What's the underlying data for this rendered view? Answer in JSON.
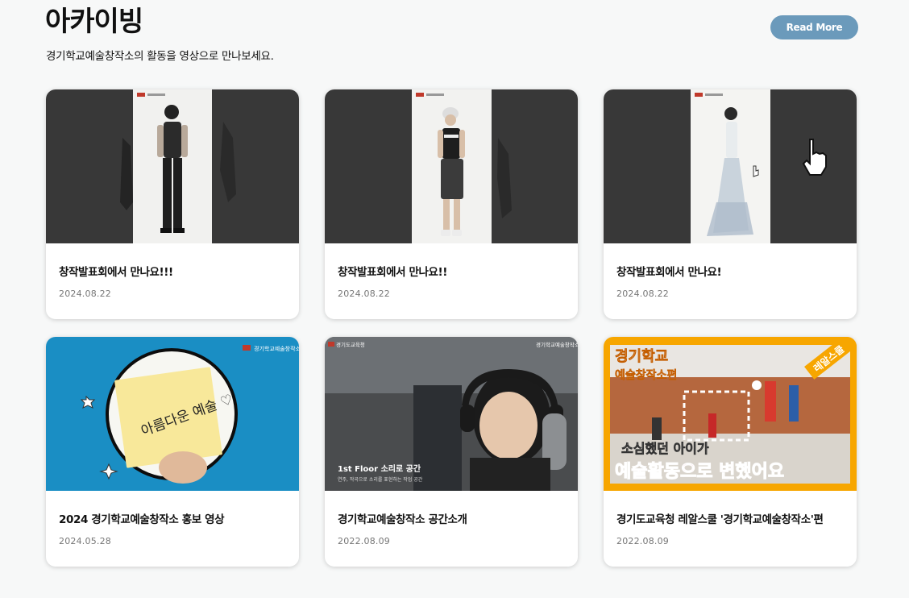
{
  "header": {
    "title": "아카이빙",
    "description": "경기학교예술창작소의 활동을 영상으로 만나보세요.",
    "read_more_label": "Read More"
  },
  "colors": {
    "read_more_bg": "#6b9abb",
    "dark_thumb_bg": "#3a3a3a",
    "blue_thumb_bg": "#1a8ec4",
    "yellow_thumb_bg": "#f7a600"
  },
  "cards": [
    {
      "title": "창작발표회에서 만나요!!!",
      "date": "2024.08.22",
      "thumb_icon": "fashion-model-photo-icon"
    },
    {
      "title": "창작발표회에서 만나요!!",
      "date": "2024.08.22",
      "thumb_icon": "fashion-model-photo-icon"
    },
    {
      "title": "창작발표회에서 만나요!",
      "date": "2024.08.22",
      "thumb_icon": "gown-model-photo-icon"
    },
    {
      "title": "2024 경기학교예술창작소 홍보 영상",
      "date": "2024.05.28",
      "thumb_icon": "sticky-note-icon",
      "thumb_text": "아름다운 예술 ♡",
      "thumb_logo": "경기학교예술창작소"
    },
    {
      "title": "경기학교예술창작소 공간소개",
      "date": "2022.08.09",
      "thumb_icon": "recording-studio-icon",
      "thumb_caption": "1st Floor 소리로 공간",
      "thumb_sub": "연주, 작곡으로 소리를 표현하는 작업 공간",
      "thumb_logo_left": "경기도교육청",
      "thumb_logo_right": "경기학교예술창작소"
    },
    {
      "title": "경기도교육청 레알스쿨 '경기학교예술창작소'편",
      "date": "2022.08.09",
      "thumb_icon": "school-gym-icon",
      "thumb_head_1": "경기학교",
      "thumb_head_2": "예술창작소편",
      "thumb_badge": "레알스쿨",
      "thumb_line_1": "소심했던 아이가",
      "thumb_line_2": "예술활동으로 변했어요"
    }
  ]
}
